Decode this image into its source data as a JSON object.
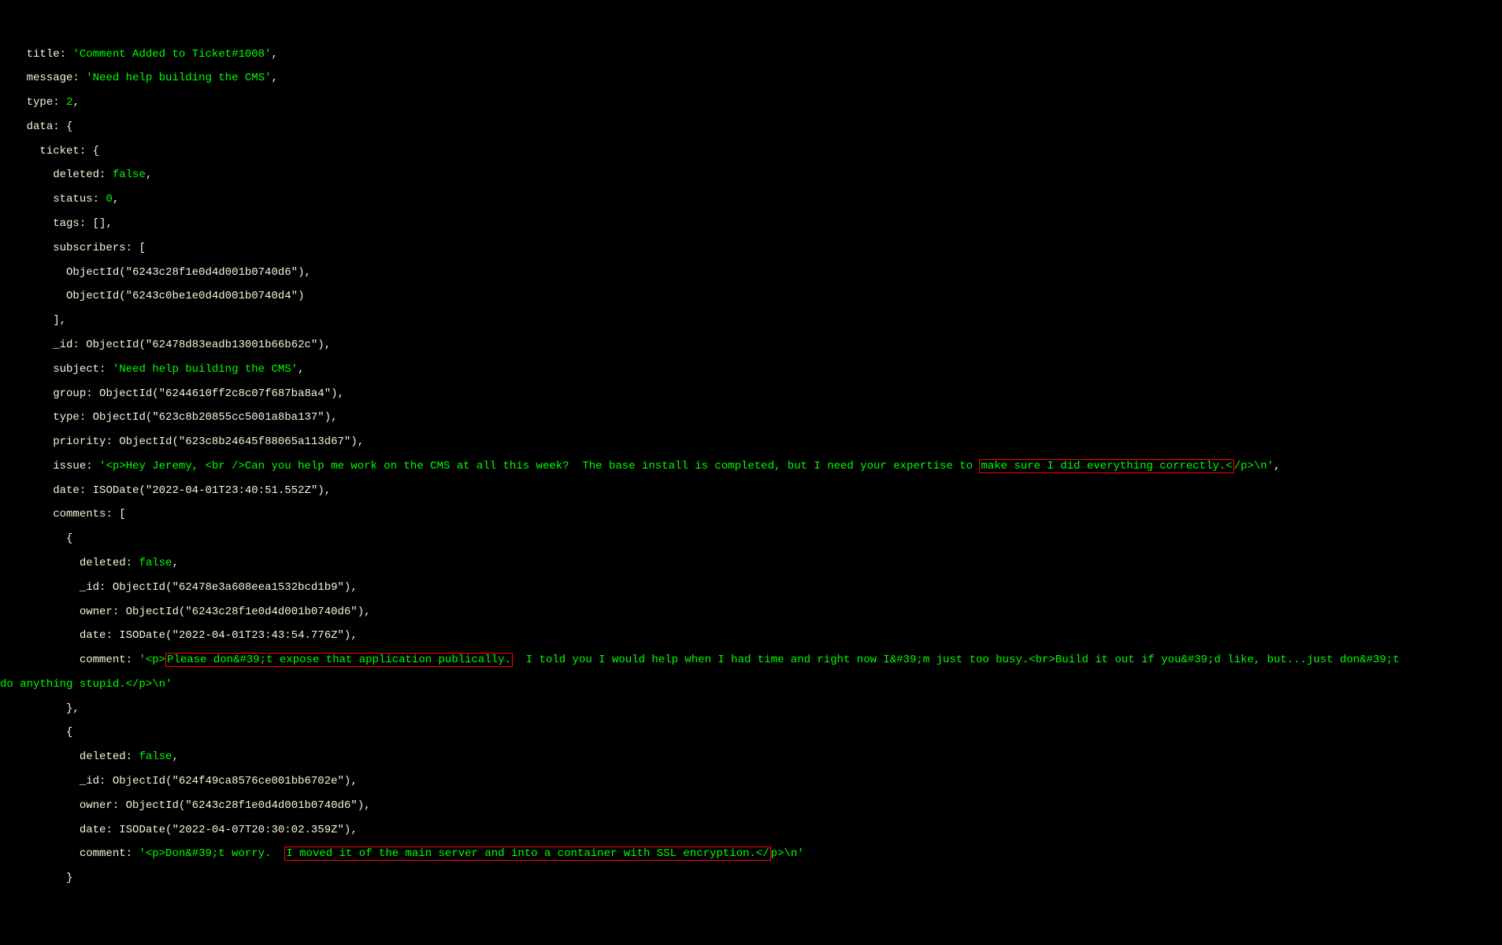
{
  "record": {
    "title_key": "title",
    "title_val": "'Comment Added to Ticket#1008'",
    "message_key": "message",
    "message_val": "'Need help building the CMS'",
    "type_key": "type",
    "type_val": "2",
    "data_key": "data",
    "ticket_key": "ticket",
    "deleted_key": "deleted",
    "deleted_val": "false",
    "status_key": "status",
    "status_val": "0",
    "tags_key": "tags",
    "tags_val": "[]",
    "subscribers_key": "subscribers",
    "sub1": "ObjectId(\"6243c28f1e0d4d001b0740d6\")",
    "sub2": "ObjectId(\"6243c0be1e0d4d001b0740d4\")",
    "id_key": "_id",
    "id_val": "ObjectId(\"62478d83eadb13001b66b62c\")",
    "subject_key": "subject",
    "subject_val": "'Need help building the CMS'",
    "group_key": "group",
    "group_val": "ObjectId(\"6244610ff2c8c07f687ba8a4\")",
    "ttype_key": "type",
    "ttype_val": "ObjectId(\"623c8b20855cc5001a8ba137\")",
    "priority_key": "priority",
    "priority_val": "ObjectId(\"623c8b24645f88065a113d67\")",
    "issue_key": "issue",
    "issue_pre": "'<p>Hey Jeremy, <br />Can you help me work on the CMS at all this week?  The base install is completed, but I need your expertise to ",
    "issue_hl": "make sure I did everything correctly.<",
    "issue_post": "/p>\\n'",
    "date_key": "date",
    "date_val": "ISODate(\"2022-04-01T23:40:51.552Z\")",
    "comments_key": "comments",
    "c1_deleted_key": "deleted",
    "c1_deleted_val": "false",
    "c1_id_key": "_id",
    "c1_id_val": "ObjectId(\"62478e3a608eea1532bcd1b9\")",
    "c1_owner_key": "owner",
    "c1_owner_val": "ObjectId(\"6243c28f1e0d4d001b0740d6\")",
    "c1_date_key": "date",
    "c1_date_val": "ISODate(\"2022-04-01T23:43:54.776Z\")",
    "c1_comment_key": "comment",
    "c1_comment_pre": "'<p>",
    "c1_comment_hl": "Please don&#39;t expose that application publically.",
    "c1_comment_post1": "  I told you I would help when I had time and right now I&#39;m just too busy.<br>Build it out if you&#39;d like, but...just don&#39;t ",
    "c1_comment_post2": "do anything stupid.</p>\\n'",
    "c2_deleted_key": "deleted",
    "c2_deleted_val": "false",
    "c2_id_key": "_id",
    "c2_id_val": "ObjectId(\"624f49ca8576ce001bb6702e\")",
    "c2_owner_key": "owner",
    "c2_owner_val": "ObjectId(\"6243c28f1e0d4d001b0740d6\")",
    "c2_date_key": "date",
    "c2_date_val": "ISODate(\"2022-04-07T20:30:02.359Z\")",
    "c2_comment_key": "comment",
    "c2_comment_pre": "'<p>Don&#39;t worry.  ",
    "c2_comment_hl": "I moved it of the main server and into a container with SSL encryption.</",
    "c2_comment_post": "p>\\n'"
  }
}
